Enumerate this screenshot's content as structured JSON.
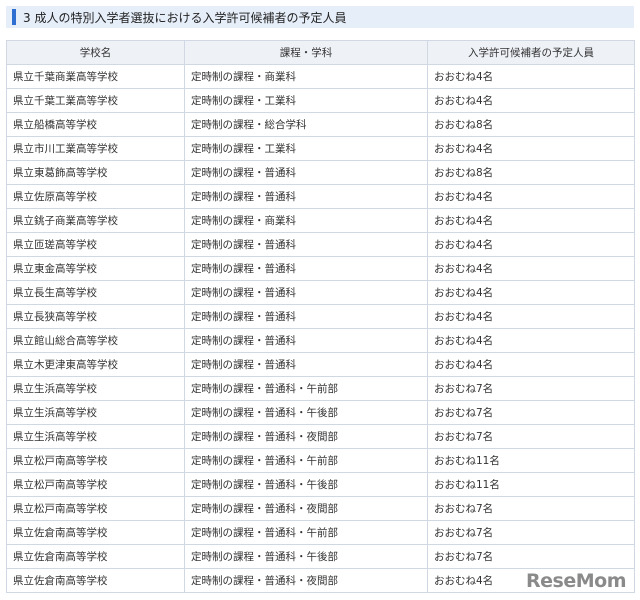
{
  "section": {
    "title": "3 成人の特別入学者選抜における入学許可候補者の予定人員"
  },
  "table": {
    "headers": [
      "学校名",
      "課程・学科",
      "入学許可候補者の予定人員"
    ],
    "rows": [
      [
        "県立千葉商業高等学校",
        "定時制の課程・商業科",
        "おおむね4名"
      ],
      [
        "県立千葉工業高等学校",
        "定時制の課程・工業科",
        "おおむね4名"
      ],
      [
        "県立船橋高等学校",
        "定時制の課程・総合学科",
        "おおむね8名"
      ],
      [
        "県立市川工業高等学校",
        "定時制の課程・工業科",
        "おおむね4名"
      ],
      [
        "県立東葛飾高等学校",
        "定時制の課程・普通科",
        "おおむね8名"
      ],
      [
        "県立佐原高等学校",
        "定時制の課程・普通科",
        "おおむね4名"
      ],
      [
        "県立銚子商業高等学校",
        "定時制の課程・商業科",
        "おおむね4名"
      ],
      [
        "県立匝瑳高等学校",
        "定時制の課程・普通科",
        "おおむね4名"
      ],
      [
        "県立東金高等学校",
        "定時制の課程・普通科",
        "おおむね4名"
      ],
      [
        "県立長生高等学校",
        "定時制の課程・普通科",
        "おおむね4名"
      ],
      [
        "県立長狭高等学校",
        "定時制の課程・普通科",
        "おおむね4名"
      ],
      [
        "県立館山総合高等学校",
        "定時制の課程・普通科",
        "おおむね4名"
      ],
      [
        "県立木更津東高等学校",
        "定時制の課程・普通科",
        "おおむね4名"
      ],
      [
        "県立生浜高等学校",
        "定時制の課程・普通科・午前部",
        "おおむね7名"
      ],
      [
        "県立生浜高等学校",
        "定時制の課程・普通科・午後部",
        "おおむね7名"
      ],
      [
        "県立生浜高等学校",
        "定時制の課程・普通科・夜間部",
        "おおむね7名"
      ],
      [
        "県立松戸南高等学校",
        "定時制の課程・普通科・午前部",
        "おおむね11名"
      ],
      [
        "県立松戸南高等学校",
        "定時制の課程・普通科・午後部",
        "おおむね11名"
      ],
      [
        "県立松戸南高等学校",
        "定時制の課程・普通科・夜間部",
        "おおむね7名"
      ],
      [
        "県立佐倉南高等学校",
        "定時制の課程・普通科・午前部",
        "おおむね7名"
      ],
      [
        "県立佐倉南高等学校",
        "定時制の課程・普通科・午後部",
        "おおむね7名"
      ],
      [
        "県立佐倉南高等学校",
        "定時制の課程・普通科・夜間部",
        "おおむね4名"
      ]
    ]
  },
  "watermark": "ReseMom"
}
